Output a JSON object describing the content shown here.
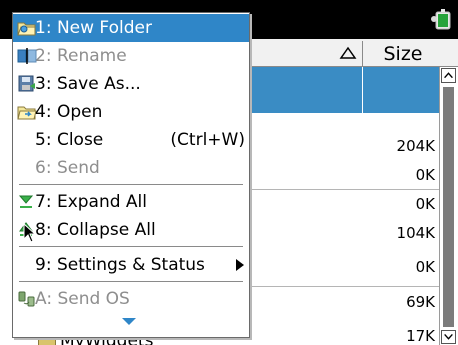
{
  "window": {
    "column_size": "Size"
  },
  "files": {
    "sizes": [
      "204K",
      "0K",
      "0K",
      "104K",
      "0K",
      "69K",
      "17K"
    ],
    "peek_name": "MyWidgets"
  },
  "menu": {
    "items": [
      {
        "label": "1: New Folder",
        "icon": "new-folder-icon",
        "enabled": true,
        "highlighted": true
      },
      {
        "label": "2: Rename",
        "icon": "rename-icon",
        "enabled": false
      },
      {
        "label": "3: Save As...",
        "icon": "save-as-icon",
        "enabled": true
      },
      {
        "label": "4: Open",
        "icon": "open-folder-icon",
        "enabled": true
      },
      {
        "label": "5: Close",
        "shortcut": "(Ctrl+W)",
        "enabled": true
      },
      {
        "label": "6: Send",
        "enabled": false
      },
      {
        "label": "7: Expand All",
        "icon": "expand-all-icon",
        "enabled": true
      },
      {
        "label": "8: Collapse All",
        "icon": "collapse-all-icon",
        "enabled": true
      },
      {
        "label": "9: Settings & Status",
        "icon": "submenu-arrow-icon",
        "enabled": true
      },
      {
        "label": "A: Send OS",
        "icon": "send-os-icon",
        "enabled": false
      }
    ]
  },
  "colors": {
    "highlight": "#2f86c8",
    "selected_row": "#3a8cc4",
    "title_bar": "#000000",
    "disabled_text": "#8e8e8e"
  }
}
